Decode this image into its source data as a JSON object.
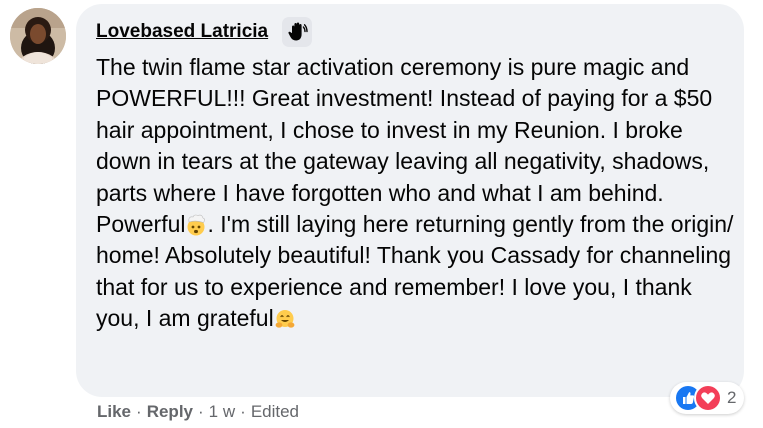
{
  "comment": {
    "author": "Lovebased Latricia",
    "badge_icon": "raised-hand-icon",
    "text_part1": "The twin flame star activation ceremony is pure magic and POWERFUL!!! Great investment! Instead of paying for a $50 hair appointment, I chose to invest in my Reunion. I broke down in tears at the gateway leaving all negativity, shadows, parts where I have forgotten who and what I am behind. Powerful",
    "emoji1": "exploding-head-emoji",
    "text_part2": ". I'm still laying here returning gently from the origin/ home! Absolutely beautiful! Thank you Cassady for channeling that for us to experience and remember! I love you, I thank you, I am grateful",
    "emoji2": "hugging-face-emoji",
    "bubble_color": "#f0f2f5"
  },
  "actions": {
    "like": "Like",
    "sep1": "·",
    "reply": "Reply",
    "sep2": "·",
    "time": "1 w",
    "sep3": "·",
    "edited": "Edited"
  },
  "reactions": {
    "icons": [
      "like-reaction-icon",
      "love-reaction-icon"
    ],
    "count": "2",
    "like_color": "#1877f2",
    "love_color": "#f33e58"
  }
}
